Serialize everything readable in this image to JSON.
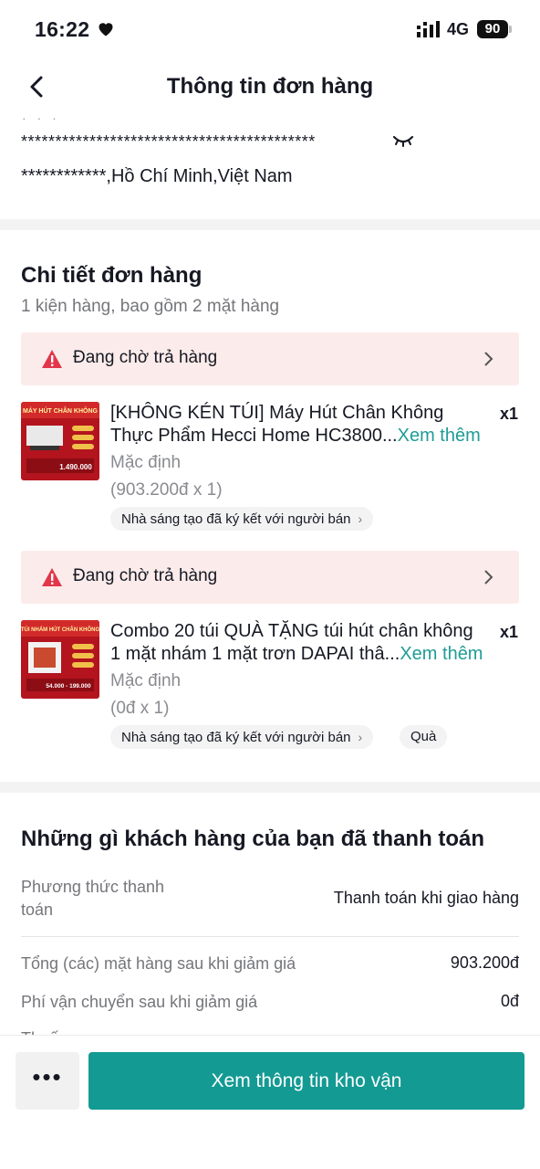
{
  "status_bar": {
    "time": "16:22",
    "network": "4G",
    "battery": "90"
  },
  "nav": {
    "title": "Thông tin đơn hàng"
  },
  "address": {
    "line1": "*******************************************",
    "line2": "************,Hồ Chí Minh,Việt Nam"
  },
  "details": {
    "title": "Chi tiết đơn hàng",
    "subtitle": "1 kiện hàng, bao gồm 2 mặt hàng",
    "items": [
      {
        "status": "Đang chờ trả hàng",
        "title_line1": "[KHÔNG KÉN TÚI] Máy Hút Chân Không",
        "title_line2": "Thực Phẩm Hecci Home HC3800...",
        "more": "Xem thêm",
        "qty": "x1",
        "variant": "Mặc định",
        "price": "(903.200đ x 1)",
        "pill": "Nhà sáng tạo đã ký kết với người bán",
        "thumb_caption": "MÁY HÚT CHÂN KHÔNG",
        "thumb_price": "1.490.000"
      },
      {
        "status": "Đang chờ trả hàng",
        "title_line1": "Combo 20 túi QUÀ TẶNG túi hút chân không",
        "title_line2": "1 mặt nhám 1 mặt trơn DAPAI thâ...",
        "more": "Xem thêm",
        "qty": "x1",
        "variant": "Mặc định",
        "price": "(0đ x 1)",
        "pill": "Nhà sáng tạo đã ký kết với người bán",
        "gift": "Quà",
        "thumb_caption": "TÚI NHÁM HÚT CHÂN KHÔNG",
        "thumb_price": "54.000 - 199.000"
      }
    ]
  },
  "payment": {
    "title": "Những gì khách hàng của bạn đã thanh toán",
    "method_label_1": "Phương thức thanh",
    "method_label_2": "toán",
    "method_value": "Thanh toán khi giao hàng",
    "subtotal_label": "Tổng (các) mặt hàng sau khi giảm giá",
    "subtotal_value": "903.200đ",
    "shipping_label": "Phí vận chuyển sau khi giảm giá",
    "shipping_value": "0đ",
    "tax_label_partial": "Thuế"
  },
  "bottom": {
    "more": "•••",
    "primary": "Xem thông tin kho vận"
  },
  "colors": {
    "accent": "#139a93",
    "link": "#1f9c96",
    "warning_bg": "#fbeceb",
    "warning_icon": "#e3364a"
  }
}
